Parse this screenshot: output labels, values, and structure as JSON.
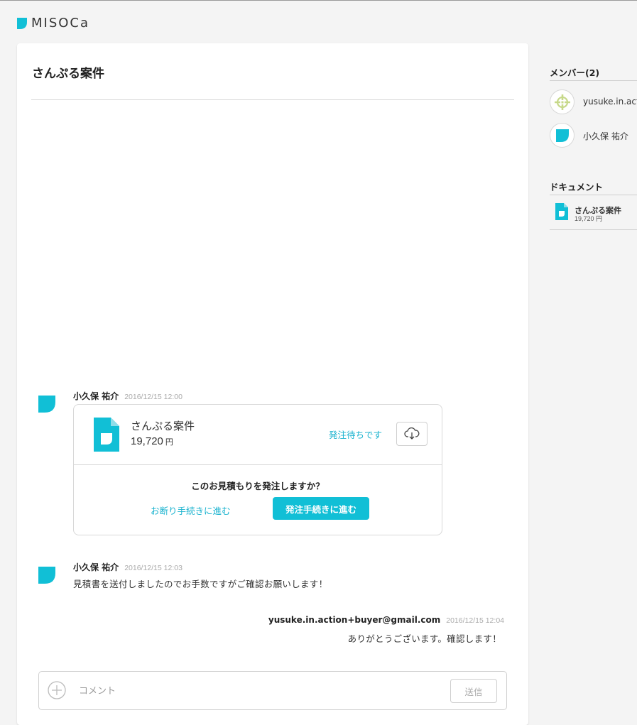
{
  "app": {
    "logo_text": "MISOCa",
    "brand_color": "#11bfd6"
  },
  "project": {
    "title": "さんぷる案件"
  },
  "messages": [
    {
      "author": "小久保 祐介",
      "time": "2016/12/15 12:00",
      "document": {
        "name": "さんぷる案件",
        "amount": "19,720",
        "currency": "円",
        "status": "発注待ちです",
        "question": "このお見積もりを発注しますか？",
        "decline_label": "お断り手続きに進む",
        "order_label": "発注手続きに進む"
      }
    },
    {
      "author": "小久保 祐介",
      "time": "2016/12/15 12:03",
      "text": "見積書を送付しましたのでお手数ですがご確認お願いします！"
    },
    {
      "author": "yusuke.in.action+buyer@gmail.com",
      "time": "2016/12/15 12:04",
      "text": "ありがとうございます。確認します！"
    }
  ],
  "comment": {
    "placeholder": "コメント",
    "value": "",
    "send_label": "送信"
  },
  "sidebar": {
    "members_heading": "メンバー(2)",
    "members": [
      {
        "name": "yusuke.in.action+buyer@gmail.com",
        "avatar": "crosshair-avatar-icon"
      },
      {
        "name": "小久保 祐介",
        "avatar": "misoca-logo-avatar-icon"
      }
    ],
    "documents_heading": "ドキュメント",
    "documents": [
      {
        "name": "さんぷる案件",
        "amount": "19,720",
        "currency": "円"
      }
    ]
  }
}
